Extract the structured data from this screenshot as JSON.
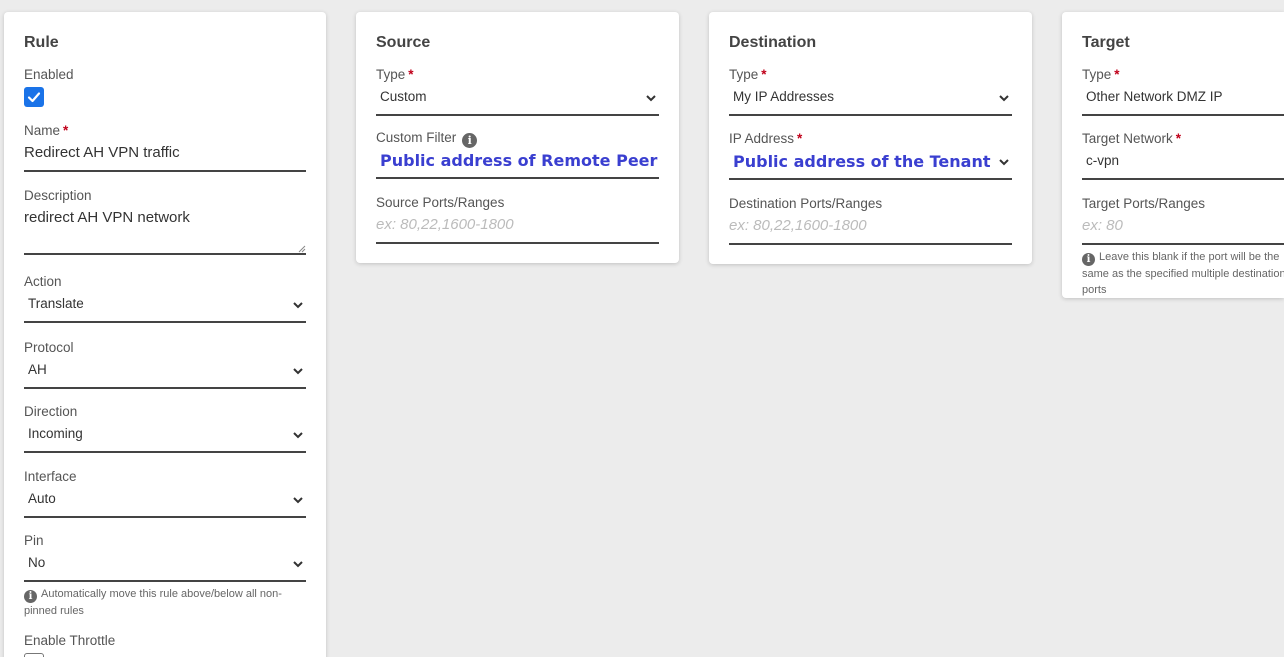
{
  "rule": {
    "title": "Rule",
    "enabled_label": "Enabled",
    "name_label": "Name",
    "name_value": "Redirect AH VPN traffic",
    "description_label": "Description",
    "description_value": "redirect AH VPN network",
    "action_label": "Action",
    "action_value": "Translate",
    "protocol_label": "Protocol",
    "protocol_value": "AH",
    "direction_label": "Direction",
    "direction_value": "Incoming",
    "interface_label": "Interface",
    "interface_value": "Auto",
    "pin_label": "Pin",
    "pin_value": "No",
    "pin_hint": "Automatically move this rule above/below all non-pinned rules",
    "throttle_label": "Enable Throttle"
  },
  "source": {
    "title": "Source",
    "type_label": "Type",
    "type_value": "Custom",
    "filter_label": "Custom Filter",
    "filter_value": "Public address of Remote Peer",
    "ports_label": "Source Ports/Ranges",
    "ports_placeholder": "ex: 80,22,1600-1800"
  },
  "destination": {
    "title": "Destination",
    "type_label": "Type",
    "type_value": "My IP Addresses",
    "ip_label": "IP Address",
    "ip_value": "Public address of the Tenant",
    "ports_label": "Destination Ports/Ranges",
    "ports_placeholder": "ex: 80,22,1600-1800"
  },
  "target": {
    "title": "Target",
    "type_label": "Type",
    "type_value": "Other Network DMZ IP",
    "network_label": "Target Network",
    "network_value": "c-vpn",
    "ports_label": "Target Ports/Ranges",
    "ports_placeholder": "ex: 80",
    "ports_hint": "Leave this blank if the port will be the same as the specified multiple destination ports"
  },
  "required_mark": "*",
  "info_glyph": "i",
  "colors": {
    "accent": "#1a73e8",
    "required": "#c0001a",
    "highlight_text": "#3a3fd0"
  }
}
